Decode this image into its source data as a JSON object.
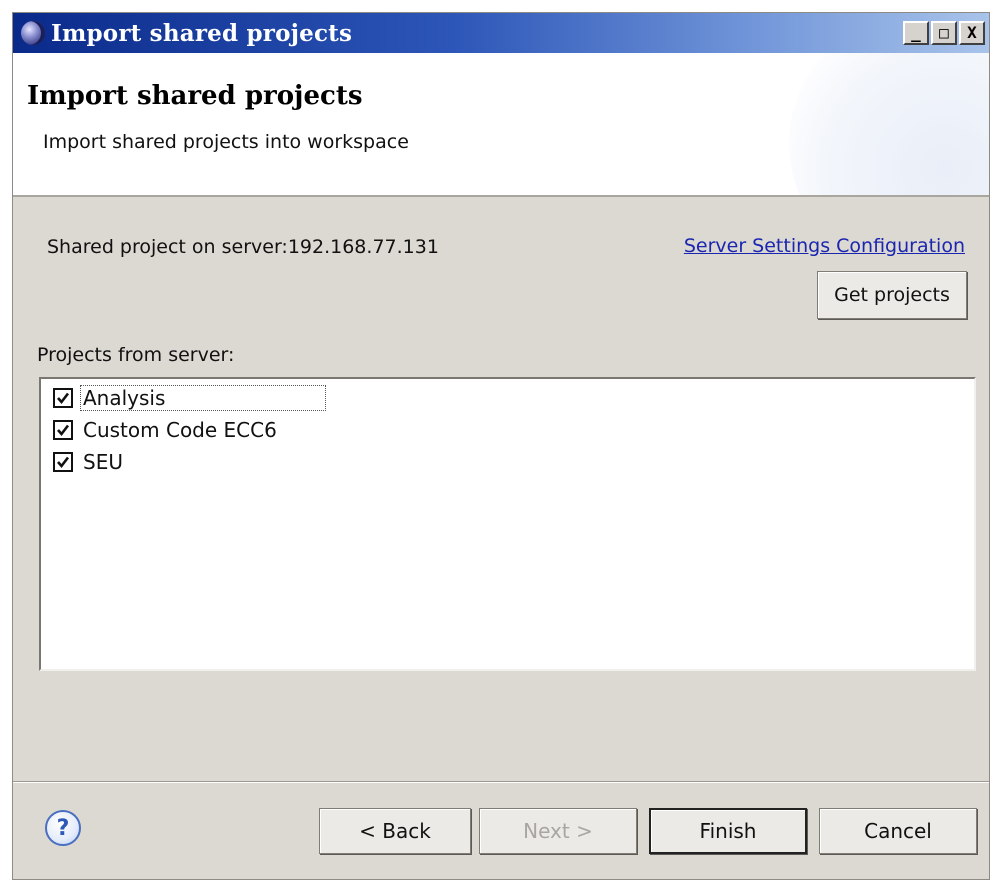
{
  "window": {
    "title": "Import shared projects",
    "controls": {
      "minimize": "_",
      "maximize": "□",
      "close": "X"
    }
  },
  "header": {
    "title": "Import shared projects",
    "subtitle": "Import shared projects into workspace"
  },
  "server": {
    "label": "Shared project on server:192.168.77.131",
    "settings_link": "Server Settings Configuration",
    "get_projects_label": "Get projects"
  },
  "projects": {
    "label": "Projects from server:",
    "items": [
      {
        "label": "Analysis",
        "checked": true
      },
      {
        "label": "Custom Code ECC6",
        "checked": true
      },
      {
        "label": "SEU",
        "checked": true
      }
    ]
  },
  "footer": {
    "help_icon": "question-mark-icon",
    "help_glyph": "?",
    "back_label": "< Back",
    "next_label": "Next >",
    "finish_label": "Finish",
    "cancel_label": "Cancel"
  },
  "colors": {
    "titlebar_start": "#0a2a8a",
    "titlebar_end": "#a9c4ea",
    "dialog_background": "#dcd8d2",
    "link": "#1a26b0"
  }
}
